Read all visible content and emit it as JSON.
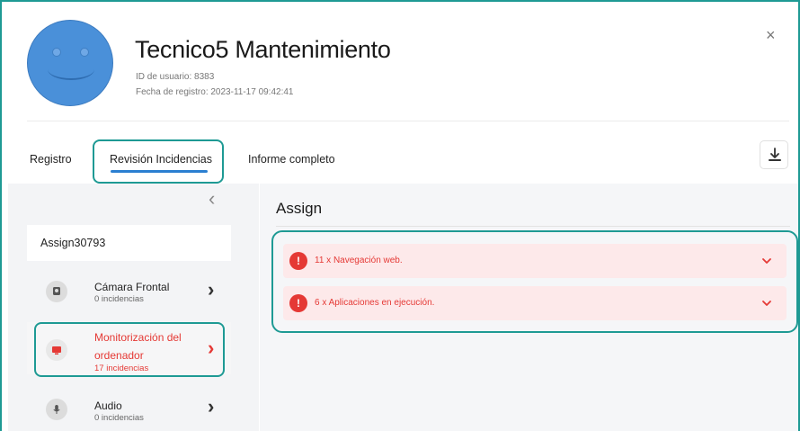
{
  "user": {
    "name": "Tecnico5 Mantenimiento",
    "id_line": "ID de usuario: 8383",
    "registered_line": "Fecha de registro: 2023-11-17 09:42:41"
  },
  "close_label": "×",
  "tabs": [
    {
      "label": "Registro"
    },
    {
      "label": "Revisión Incidencias",
      "active": true
    },
    {
      "label": "Informe completo"
    }
  ],
  "sidebar": {
    "collapse_label": "‹",
    "assign_label": "Assign30793",
    "items": [
      {
        "title": "Cámara Frontal",
        "subtitle": "0 incidencias",
        "icon": "webcam-icon",
        "alert": false
      },
      {
        "title_line1": "Monitorización del",
        "title_line2": "ordenador",
        "subtitle": "17 incidencias",
        "icon": "monitor-icon",
        "alert": true
      },
      {
        "title": "Audio",
        "subtitle": "0 incidencias",
        "icon": "microphone-icon",
        "alert": false
      }
    ]
  },
  "main": {
    "title": "Assign",
    "incidents": [
      {
        "text": "11 x Navegación web.",
        "icon_label": "!"
      },
      {
        "text": "6 x Aplicaciones en ejecución.",
        "icon_label": "!"
      }
    ]
  },
  "colors": {
    "accent": "#2b7fd1",
    "alert_red": "#e53935",
    "highlight_teal": "#1e9a94",
    "alert_bg": "#fde9ea"
  }
}
